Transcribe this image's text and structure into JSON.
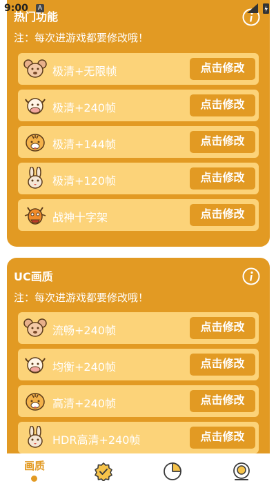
{
  "status": {
    "time": "9:00",
    "indicator": "A"
  },
  "section_hot": {
    "title": "热门功能",
    "note": "注：每次进游戏都要修改哦！",
    "items": [
      {
        "icon": "mouse-icon",
        "label": "极清+无限帧",
        "button": "点击修改"
      },
      {
        "icon": "ox-icon",
        "label": "极清+240帧",
        "button": "点击修改"
      },
      {
        "icon": "tiger-icon",
        "label": "极清+144帧",
        "button": "点击修改"
      },
      {
        "icon": "rabbit-icon",
        "label": "极清+120帧",
        "button": "点击修改"
      },
      {
        "icon": "dragon-icon",
        "label": "战神十字架",
        "button": "点击修改"
      }
    ]
  },
  "section_uc": {
    "title": "UC画质",
    "note": "注：每次进游戏都要修改哦！",
    "items": [
      {
        "icon": "mouse-icon",
        "label": "流畅+240帧",
        "button": "点击修改"
      },
      {
        "icon": "ox-icon",
        "label": "均衡+240帧",
        "button": "点击修改"
      },
      {
        "icon": "tiger-icon",
        "label": "高清+240帧",
        "button": "点击修改"
      },
      {
        "icon": "rabbit-icon",
        "label": "HDR高清+240帧",
        "button": "点击修改"
      }
    ]
  },
  "bottom_nav": {
    "active_label": "画质",
    "items": [
      "quality-tab",
      "badge-icon",
      "pie-chart-icon",
      "profile-icon"
    ]
  },
  "colors": {
    "accent": "#e29a23",
    "row_bg": "#fcd379",
    "text_light": "#ffffff"
  }
}
